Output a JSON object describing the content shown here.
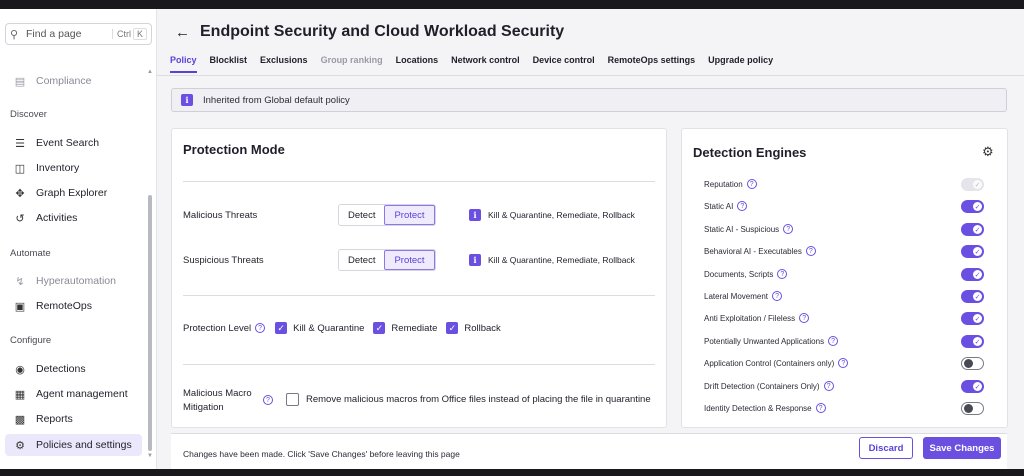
{
  "sidebar": {
    "search_placeholder": "Find a page",
    "shortcut": "Ctrl",
    "shortcut_key": "K",
    "sections": {
      "discover": "Discover",
      "automate": "Automate",
      "configure": "Configure"
    },
    "items": {
      "compliance": "Compliance",
      "event_search": "Event Search",
      "inventory": "Inventory",
      "graph_explorer": "Graph Explorer",
      "activities": "Activities",
      "hyperautomation": "Hyperautomation",
      "remoteops": "RemoteOps",
      "detections": "Detections",
      "agent_management": "Agent management",
      "reports": "Reports",
      "policies": "Policies and settings"
    }
  },
  "header": {
    "title": "Endpoint Security and Cloud Workload Security",
    "tabs": [
      "Policy",
      "Blocklist",
      "Exclusions",
      "Group ranking",
      "Locations",
      "Network control",
      "Device control",
      "RemoteOps settings",
      "Upgrade policy"
    ]
  },
  "banner": {
    "badge": "i",
    "text": "Inherited from Global default policy"
  },
  "protection": {
    "title": "Protection Mode",
    "malicious_label": "Malicious Threats",
    "suspicious_label": "Suspicious Threats",
    "detect": "Detect",
    "protect": "Protect",
    "note": "Kill & Quarantine, Remediate, Rollback",
    "level_label": "Protection Level",
    "level_items": [
      "Kill & Quarantine",
      "Remediate",
      "Rollback"
    ],
    "macro_label_1": "Malicious Macro",
    "macro_label_2": "Mitigation",
    "macro_text": "Remove malicious macros from Office files instead of placing the file in quarantine"
  },
  "engines": {
    "title": "Detection Engines",
    "items": [
      {
        "label": "Reputation",
        "state": "disabled"
      },
      {
        "label": "Static AI",
        "state": "on"
      },
      {
        "label": "Static AI - Suspicious",
        "state": "on"
      },
      {
        "label": "Behavioral AI - Executables",
        "state": "on"
      },
      {
        "label": "Documents, Scripts",
        "state": "on"
      },
      {
        "label": "Lateral Movement",
        "state": "on"
      },
      {
        "label": "Anti Exploitation / Fileless",
        "state": "on"
      },
      {
        "label": "Potentially Unwanted Applications",
        "state": "on"
      },
      {
        "label": "Application Control (Containers only)",
        "state": "off"
      },
      {
        "label": "Drift Detection (Containers Only)",
        "state": "on"
      },
      {
        "label": "Identity Detection & Response",
        "state": "off"
      }
    ]
  },
  "footer": {
    "message": "Changes have been made. Click 'Save Changes' before leaving this page",
    "discard": "Discard",
    "save": "Save Changes"
  }
}
